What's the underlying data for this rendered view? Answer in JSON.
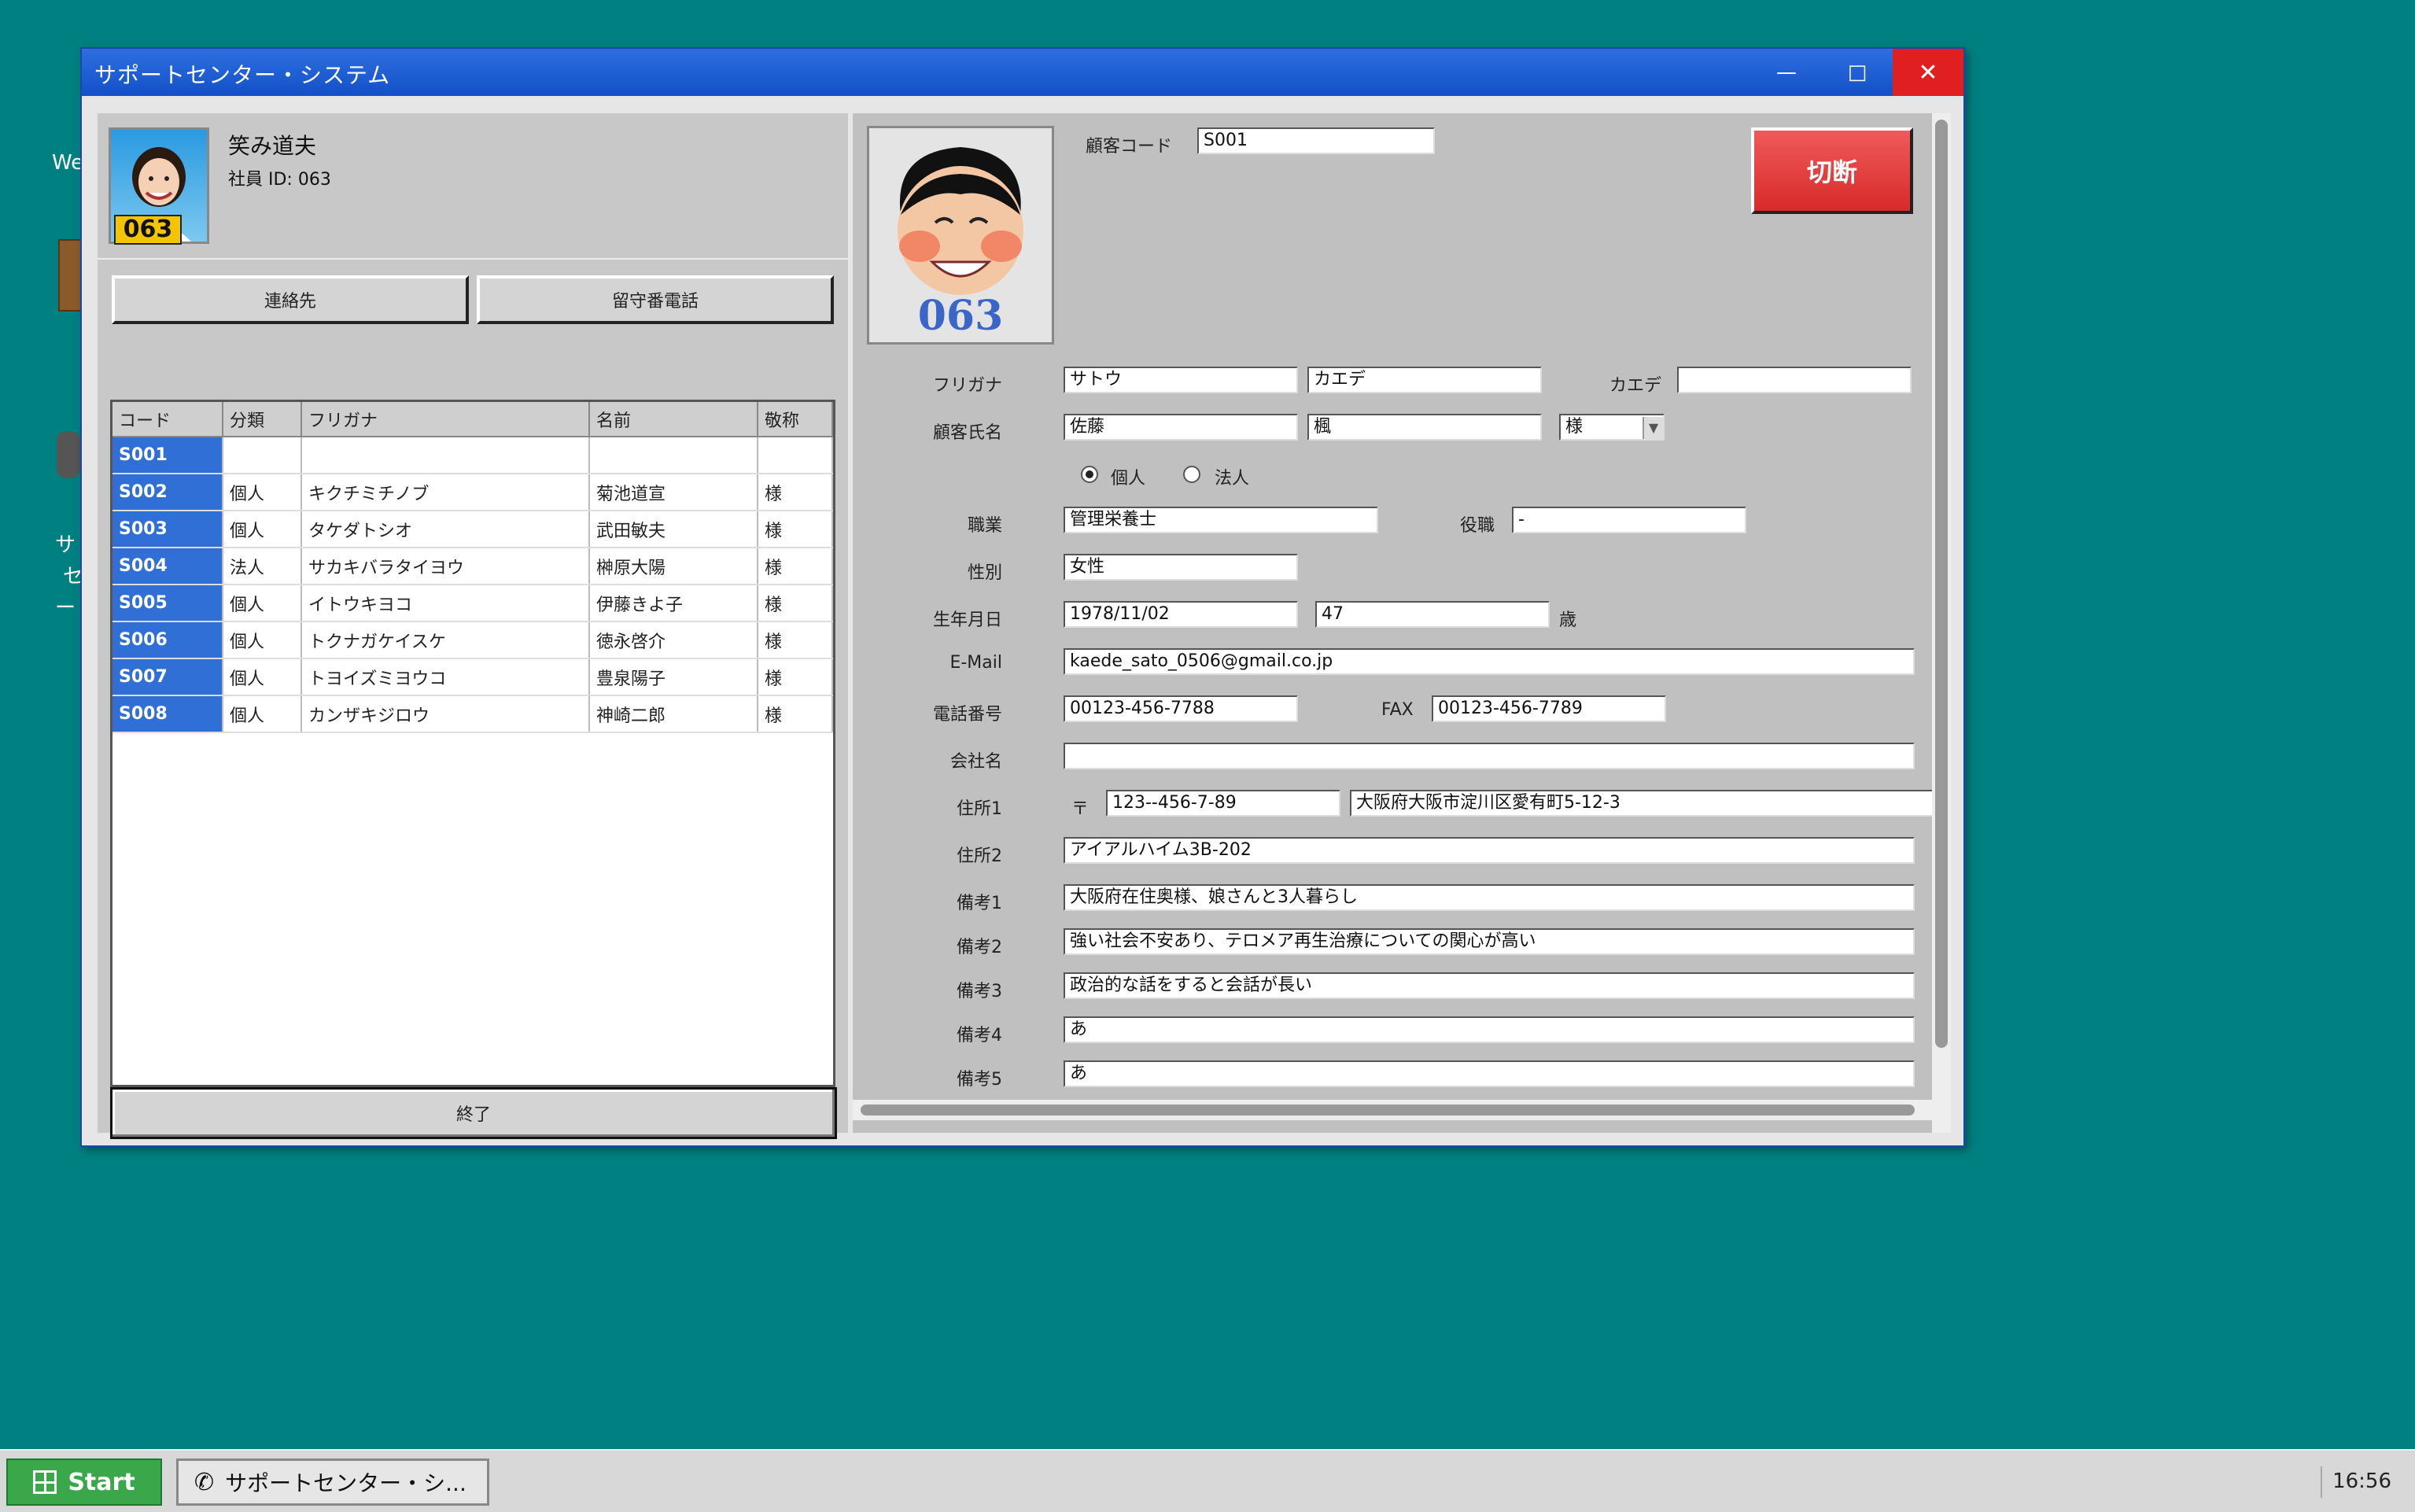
{
  "desktop": {
    "label_we": "We",
    "label_sa": "サ",
    "label_se": "セ",
    "label_dash": "ー"
  },
  "window": {
    "title": "サポートセンター・システム",
    "minimize_glyph": "—",
    "maximize_glyph": "□",
    "close_glyph": "✕"
  },
  "employee": {
    "name": "笑み道夫",
    "id_label": "社員 ID: 063",
    "badge": "063"
  },
  "left_buttons": {
    "contacts": "連絡先",
    "voicemail": "留守番電話",
    "exit": "終了"
  },
  "customer_table": {
    "headers": [
      "コード",
      "分類",
      "フリガナ",
      "名前",
      "敬称"
    ],
    "rows": [
      [
        "S001",
        "",
        "",
        "",
        ""
      ],
      [
        "S002",
        "個人",
        "キクチミチノブ",
        "菊池道宣",
        "様"
      ],
      [
        "S003",
        "個人",
        "タケダトシオ",
        "武田敏夫",
        "様"
      ],
      [
        "S004",
        "法人",
        "サカキバラタイヨウ",
        "榊原大陽",
        "様"
      ],
      [
        "S005",
        "個人",
        "イトウキヨコ",
        "伊藤きよ子",
        "様"
      ],
      [
        "S006",
        "個人",
        "トクナガケイスケ",
        "徳永啓介",
        "様"
      ],
      [
        "S007",
        "個人",
        "トヨイズミヨウコ",
        "豊泉陽子",
        "様"
      ],
      [
        "S008",
        "個人",
        "カンザキジロウ",
        "神崎二郎",
        "様"
      ]
    ]
  },
  "customer_photo": {
    "badge": "063"
  },
  "form": {
    "customer_code_label": "顧客コード",
    "customer_code": "S001",
    "disconnect": "切断",
    "furigana_label": "フリガナ",
    "furigana_last": "サトウ",
    "furigana_first": "カエデ",
    "kaede_label": "カエデ",
    "kaede_value": "",
    "name_label": "顧客氏名",
    "name_last": "佐藤",
    "name_first": "楓",
    "honorific": "様",
    "radio_individual": "個人",
    "radio_corporate": "法人",
    "occupation_label": "職業",
    "occupation": "管理栄養士",
    "position_label": "役職",
    "position": "-",
    "gender_label": "性別",
    "gender": "女性",
    "birthday_label": "生年月日",
    "birthday": "1978/11/02",
    "age": "47",
    "age_unit": "歳",
    "email_label": "E-Mail",
    "email": "kaede_sato_0506@gmail.co.jp",
    "phone_label": "電話番号",
    "phone": "00123-456-7788",
    "fax_label": "FAX",
    "fax": "00123-456-7789",
    "company_label": "会社名",
    "company": "",
    "address1_label": "住所1",
    "postal_mark": "〒",
    "postal": "123--456-7-89",
    "address1": "大阪府大阪市淀川区愛有町5-12-3",
    "address2_label": "住所2",
    "address2": "アイアルハイム3B-202",
    "note1_label": "備考1",
    "note1": "大阪府在住奥様、娘さんと3人暮らし",
    "note2_label": "備考2",
    "note2": "強い社会不安あり、テロメア再生治療についての関心が高い",
    "note3_label": "備考3",
    "note3": "政治的な話をすると会話が長い",
    "note4_label": "備考4",
    "note4": "あ",
    "note5_label": "備考5",
    "note5": "あ"
  },
  "taskbar": {
    "start": "Start",
    "task_label": "サポートセンター・シ...",
    "clock": "16:56"
  },
  "colors": {
    "desktop": "#008080",
    "titlebar": "#1e5fd8",
    "close": "#e02020",
    "code_cell": "#2f6fd6",
    "disconnect": "#e03838",
    "badge": "#f5c400"
  }
}
